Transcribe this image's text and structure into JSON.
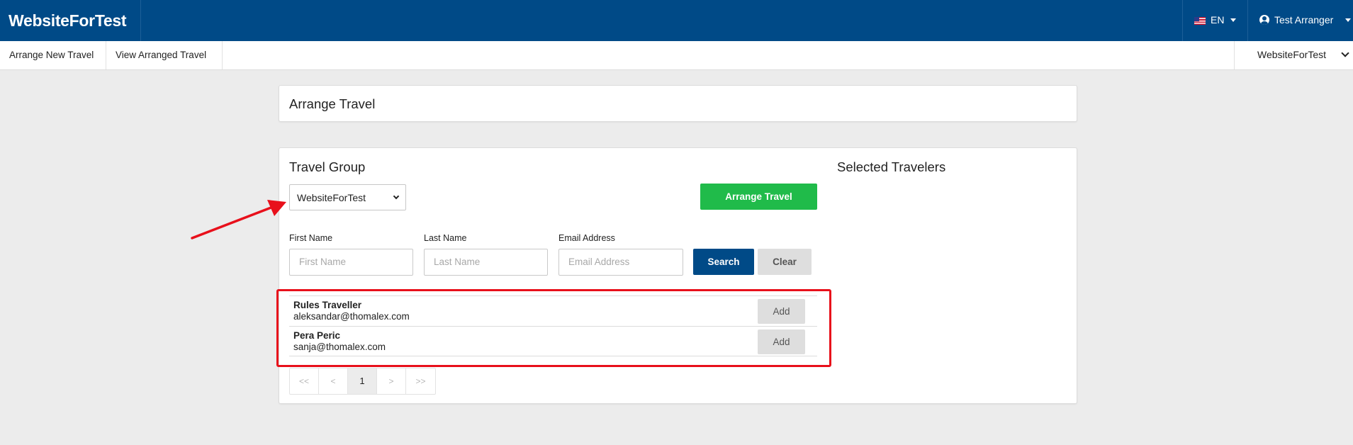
{
  "header": {
    "brand": "WebsiteForTest",
    "language": "EN",
    "user": "Test Arranger"
  },
  "nav": {
    "items": [
      {
        "label": "Arrange New Travel"
      },
      {
        "label": "View Arranged Travel"
      }
    ],
    "org_selector": "WebsiteForTest"
  },
  "page": {
    "title": "Arrange Travel"
  },
  "travel_group": {
    "heading": "Travel Group",
    "selected_group": "WebsiteForTest",
    "arrange_button": "Arrange Travel",
    "selected_heading": "Selected Travelers"
  },
  "search": {
    "first_name": {
      "label": "First Name",
      "placeholder": "First Name",
      "value": ""
    },
    "last_name": {
      "label": "Last Name",
      "placeholder": "Last Name",
      "value": ""
    },
    "email": {
      "label": "Email Address",
      "placeholder": "Email Address",
      "value": ""
    },
    "search_button": "Search",
    "clear_button": "Clear"
  },
  "results": [
    {
      "name": "Rules Traveller",
      "email": "aleksandar@thomalex.com",
      "action": "Add"
    },
    {
      "name": "Pera Peric",
      "email": "sanja@thomalex.com",
      "action": "Add"
    }
  ],
  "pagination": {
    "first": "<<",
    "prev": "<",
    "current": "1",
    "next": ">",
    "last": ">>"
  },
  "colors": {
    "header_bg": "#004a87",
    "accent_green": "#20bb4a",
    "annotation_red": "#e8101b"
  }
}
